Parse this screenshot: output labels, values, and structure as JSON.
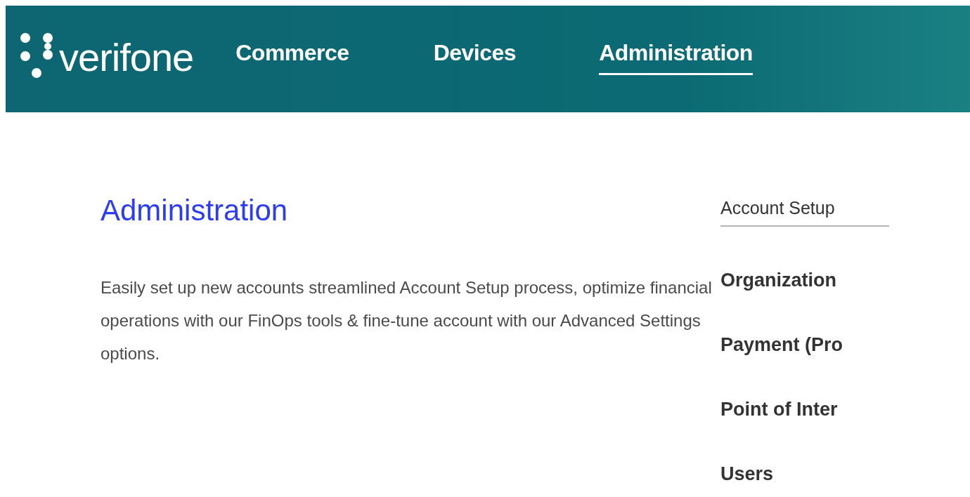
{
  "header": {
    "logo_text": "verifone",
    "nav": [
      {
        "label": "Commerce",
        "selected": false
      },
      {
        "label": "Devices",
        "selected": false
      },
      {
        "label": "Administration",
        "selected": true
      }
    ]
  },
  "main": {
    "title": "Administration",
    "description": "Easily set up new accounts streamlined Account Setup process, optimize financial operations with our FinOps tools & fine-tune account with our Advanced Settings options."
  },
  "side_panel": {
    "heading": "Account Setup",
    "items": [
      "Organization",
      "Payment (Pro",
      "Point of Inter",
      "Users"
    ]
  }
}
